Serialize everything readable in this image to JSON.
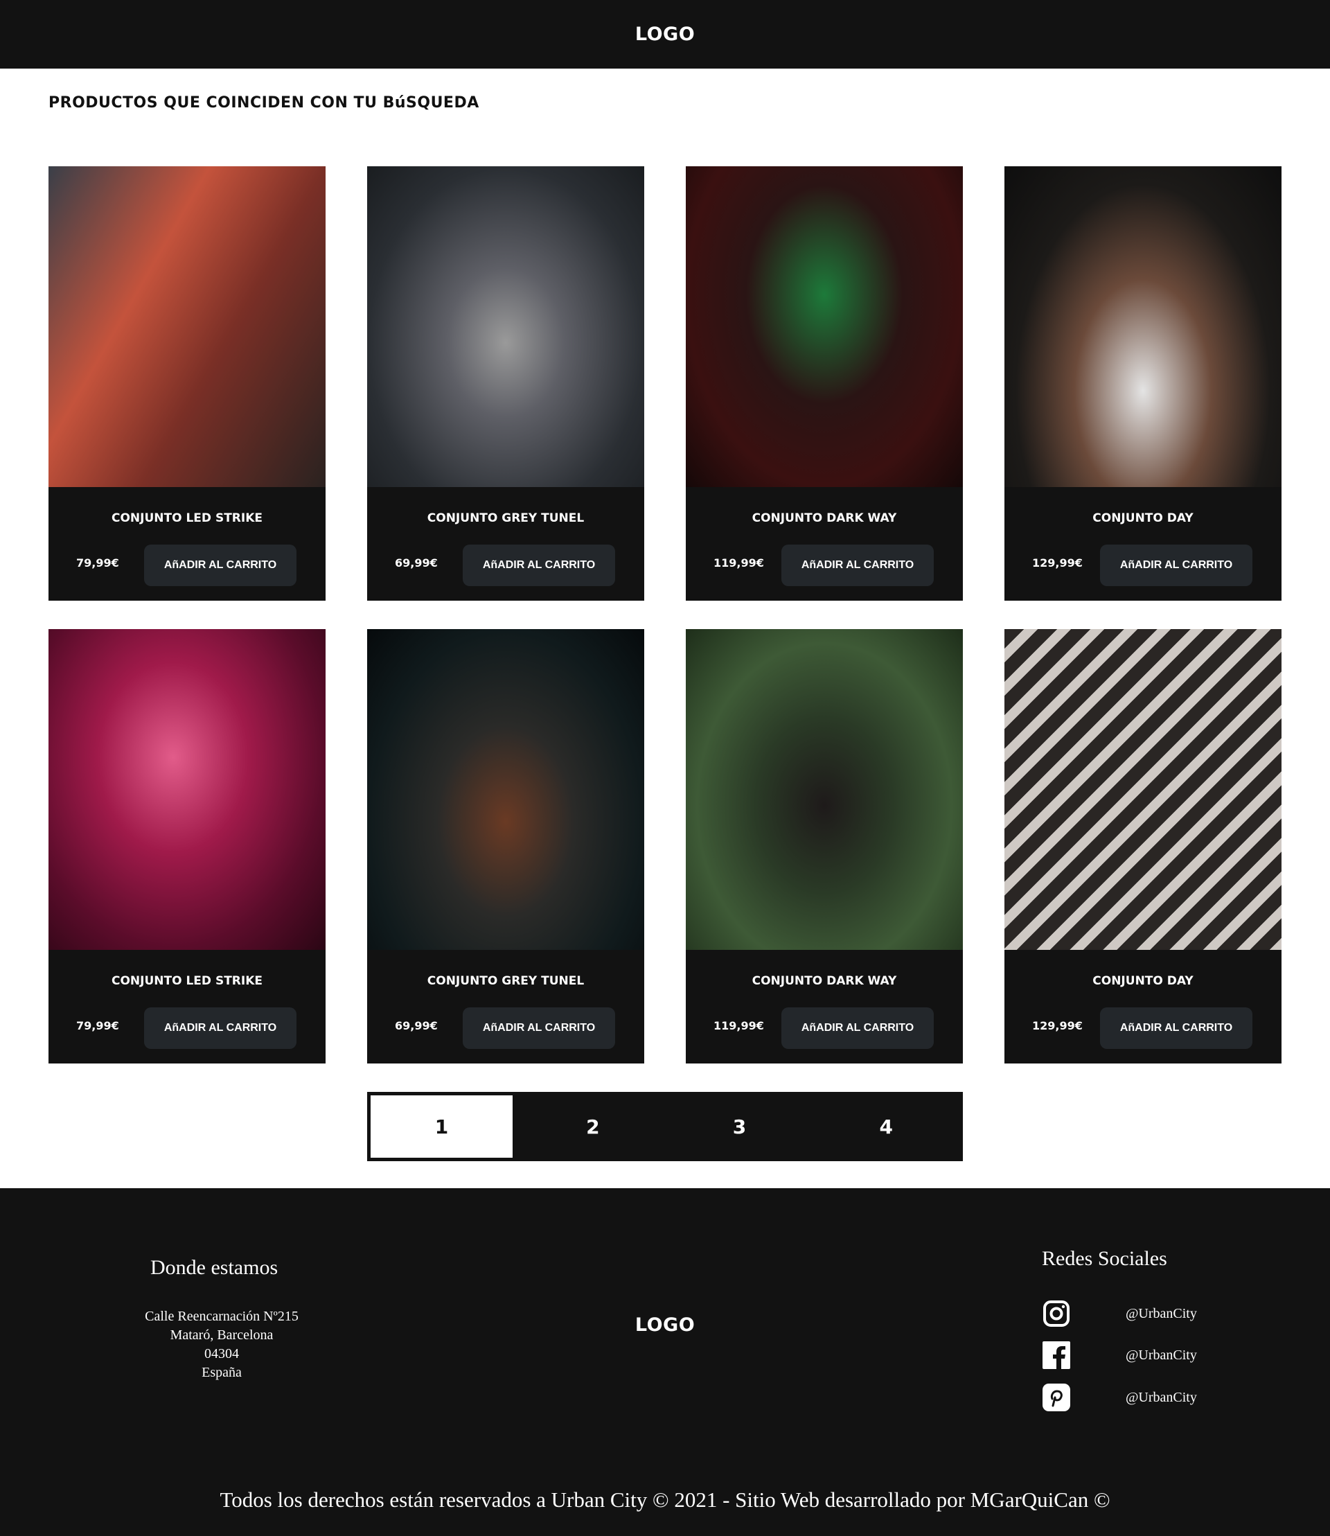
{
  "header": {
    "logo": "LOGO"
  },
  "page_title": "PRODUCTOS QUE COINCIDEN CON TU BúSQUEDA",
  "add_to_cart_label": "AñADIR AL CARRITO",
  "products": [
    {
      "name": "CONJUNTO LED STRIKE",
      "price": "79,99€",
      "bg": "linear-gradient(120deg,#3a3f48 0%,#c4533c 35%,#7a2f26 60%,#2a2220 100%)"
    },
    {
      "name": "CONJUNTO GREY TUNEL",
      "price": "69,99€",
      "bg": "radial-gradient(ellipse at 50% 55%,#9a9a9a 0%,#5e5f66 30%,#2a2e33 70%,#1a1d20 100%)"
    },
    {
      "name": "CONJUNTO DARK WAY",
      "price": "119,99€",
      "bg": "radial-gradient(ellipse at 50% 40%,#1d7a3a 0%,#2a1414 40%,#3a1010 70%,#150808 100%)"
    },
    {
      "name": "CONJUNTO DAY",
      "price": "129,99€",
      "bg": "radial-gradient(ellipse at 50% 70%,#e4e4e4 0%,#6b4a3a 35%,#1c1a18 65%,#0e0e0e 100%)"
    },
    {
      "name": "CONJUNTO LED STRIKE",
      "price": "79,99€",
      "bg": "radial-gradient(ellipse at 45% 40%,#e25c8a 0%,#a01a4a 35%,#5a0c2a 70%,#2a0614 100%)"
    },
    {
      "name": "CONJUNTO GREY TUNEL",
      "price": "69,99€",
      "bg": "radial-gradient(ellipse at 50% 60%,#6a3a24 0%,#2a2a28 35%,#101a1c 70%,#060a0c 100%)"
    },
    {
      "name": "CONJUNTO DARK WAY",
      "price": "119,99€",
      "bg": "radial-gradient(ellipse at 50% 55%,#1e1a1a 0%,#2a3a26 35%,#3e5a36 65%,#1e2e1a 100%)"
    },
    {
      "name": "CONJUNTO DAY",
      "price": "129,99€",
      "bg": "repeating-linear-gradient(135deg,#2a2624 0 20px,#cfc9c4 20px 34px),#333"
    }
  ],
  "pagination": {
    "pages": [
      "1",
      "2",
      "3",
      "4"
    ],
    "active": "1"
  },
  "footer": {
    "location_title": "Donde estamos",
    "address": [
      "Calle Reencarnación Nº215",
      "Mataró, Barcelona",
      "04304",
      "España"
    ],
    "logo": "LOGO",
    "social_title": "Redes Sociales",
    "social": [
      {
        "icon": "instagram-icon",
        "handle": "@UrbanCity"
      },
      {
        "icon": "facebook-icon",
        "handle": "@UrbanCity"
      },
      {
        "icon": "pinterest-icon",
        "handle": "@UrbanCity"
      }
    ],
    "copyright": "Todos los derechos están reservados a Urban City © 2021  - Sitio Web desarrollado por MGarQuiCan ©"
  }
}
